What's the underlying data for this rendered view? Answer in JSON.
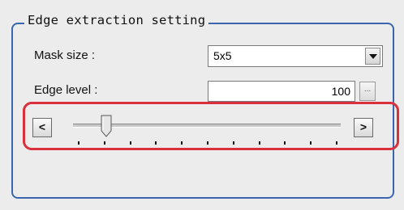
{
  "group": {
    "title": "Edge extraction setting"
  },
  "mask_size": {
    "label": "Mask size :",
    "value": "5x5"
  },
  "edge_level": {
    "label": "Edge level :",
    "value": "100",
    "ellipsis": "..."
  },
  "slider": {
    "decrement_label": "<",
    "increment_label": ">",
    "thumb_icon": "slider-thumb",
    "tick_count": 11,
    "thumb_position_fraction": 0.1
  },
  "colors": {
    "group_border": "#3a66b0",
    "highlight_border": "#d9303c"
  }
}
